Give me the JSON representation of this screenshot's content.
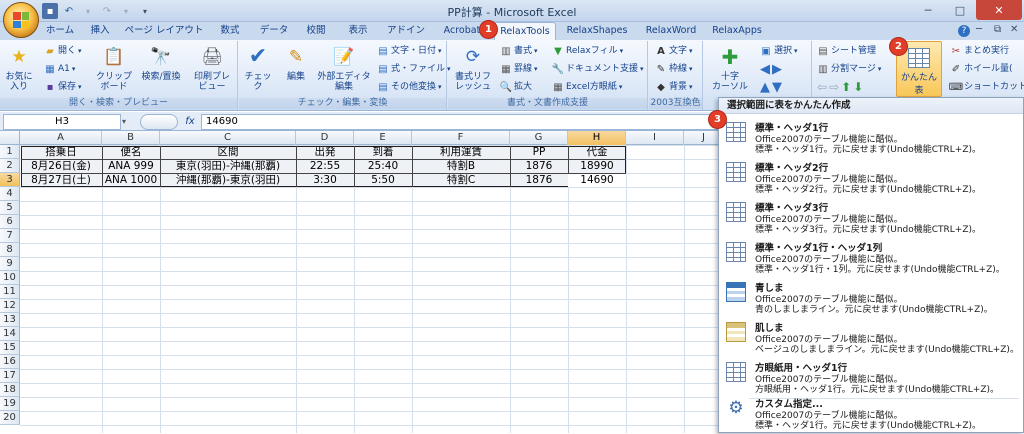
{
  "window": {
    "title": "PP計算 - Microsoft Excel",
    "min": "─",
    "max": "□",
    "close": "✕"
  },
  "tabs": [
    "ホーム",
    "挿入",
    "ページ レイアウト",
    "数式",
    "データ",
    "校閲",
    "表示",
    "アドイン",
    "Acrobat",
    "RelaxTools",
    "RelaxShapes",
    "RelaxWord",
    "RelaxApps"
  ],
  "active_tab": "RelaxTools",
  "badges": [
    "1",
    "2",
    "3"
  ],
  "ribbon": {
    "groups": [
      {
        "label": "開く・検索・プレビュー"
      },
      {
        "label": "チェック・編集・変換"
      },
      {
        "label": "書式・文書作成支援"
      },
      {
        "label": "2003互換色"
      }
    ],
    "fav": "お気に\n入り",
    "open": "開く",
    "a1": "A1",
    "save": "保存",
    "clipboard": "クリップ\nボード",
    "search": "検索/置換",
    "print": "印刷プレ\nビュー",
    "check": "チェック",
    "edit": "編集",
    "exteditor": "外部エディタ\n編集",
    "char_date": "文字・日付",
    "formula_file": "式・ファイル",
    "other_convert": "その他変換",
    "style_reg": "書式リフ\nレッシュ",
    "fmt": "書式",
    "border": "罫線",
    "zoom": "拡大",
    "relax_fill": "Relaxフィル",
    "doc_support": "ドキュメント支援",
    "excel_section": "Excel方眼紙",
    "text": "文字",
    "frame": "枠線",
    "background": "背景",
    "cross_cursor": "十字\nカーソル",
    "select": "選択",
    "sheet_mgmt": "シート管理",
    "split_marge": "分割マージ",
    "easy_table": "かんたん表",
    "batch_exec": "まとめ実行",
    "wheel": "ホイール量(",
    "shortcut": "ショートカット"
  },
  "namebox": "H3",
  "formula_value": "14690",
  "columns": [
    "A",
    "B",
    "C",
    "D",
    "E",
    "F",
    "G",
    "H",
    "I",
    "J"
  ],
  "rows": [
    "1",
    "2",
    "3",
    "4",
    "5",
    "6",
    "7",
    "8",
    "9",
    "10",
    "11",
    "12",
    "13",
    "14",
    "15",
    "16",
    "17",
    "18",
    "19",
    "20"
  ],
  "table": {
    "headers": [
      "搭乗日",
      "便名",
      "区間",
      "出発",
      "到着",
      "利用運賃",
      "PP",
      "代金"
    ],
    "rows": [
      [
        "8月26日(金)",
        "ANA 999",
        "東京(羽田)-沖縄(那覇)",
        "22:55",
        "25:40",
        "特割B",
        "1876",
        "18990"
      ],
      [
        "8月27日(土)",
        "ANA 1000",
        "沖縄(那覇)-東京(羽田)",
        "3:30",
        "5:50",
        "特割C",
        "1876",
        "14690"
      ]
    ]
  },
  "dropdown": {
    "title": "選択範囲に表をかんたん作成",
    "items": [
      {
        "title": "標準・ヘッダ1行",
        "d1": "Office2007のテーブル機能に酷似。",
        "d2": "標準・ヘッダ1行。元に戻せます(Undo機能CTRL+Z)。",
        "icon": "table-icon"
      },
      {
        "title": "標準・ヘッダ2行",
        "d1": "Office2007のテーブル機能に酷似。",
        "d2": "標準・ヘッダ2行。元に戻せます(Undo機能CTRL+Z)。",
        "icon": "table-icon"
      },
      {
        "title": "標準・ヘッダ3行",
        "d1": "Office2007のテーブル機能に酷似。",
        "d2": "標準・ヘッダ3行。元に戻せます(Undo機能CTRL+Z)。",
        "icon": "table-icon"
      },
      {
        "title": "標準・ヘッダ1行・ヘッダ1列",
        "d1": "Office2007のテーブル機能に酷似。",
        "d2": "標準・ヘッダ1行・1列。元に戻せます(Undo機能CTRL+Z)。",
        "icon": "table-icon"
      },
      {
        "title": "青しま",
        "d1": "Office2007のテーブル機能に酷似。",
        "d2": "青のしましまライン。元に戻せます(Undo機能CTRL+Z)。",
        "icon": "blue-stripe-table-icon"
      },
      {
        "title": "肌しま",
        "d1": "Office2007のテーブル機能に酷似。",
        "d2": "ベージュのしましまライン。元に戻せます(Undo機能CTRL+Z)。",
        "icon": "beige-stripe-table-icon"
      },
      {
        "title": "方眼紙用・ヘッダ1行",
        "d1": "Office2007のテーブル機能に酷似。",
        "d2": "方眼紙用・ヘッダ1行。元に戻せます(Undo機能CTRL+Z)。",
        "icon": "table-icon"
      },
      {
        "title": "カスタム指定...",
        "d1": "Office2007のテーブル機能に酷似。",
        "d2": "標準・ヘッダ1行。元に戻せます(Undo機能CTRL+Z)。",
        "icon": "gear-icon"
      }
    ]
  },
  "colors": {
    "accent": "#15428b",
    "badge": "#e23d28",
    "selected_header": "#f1c15f"
  }
}
